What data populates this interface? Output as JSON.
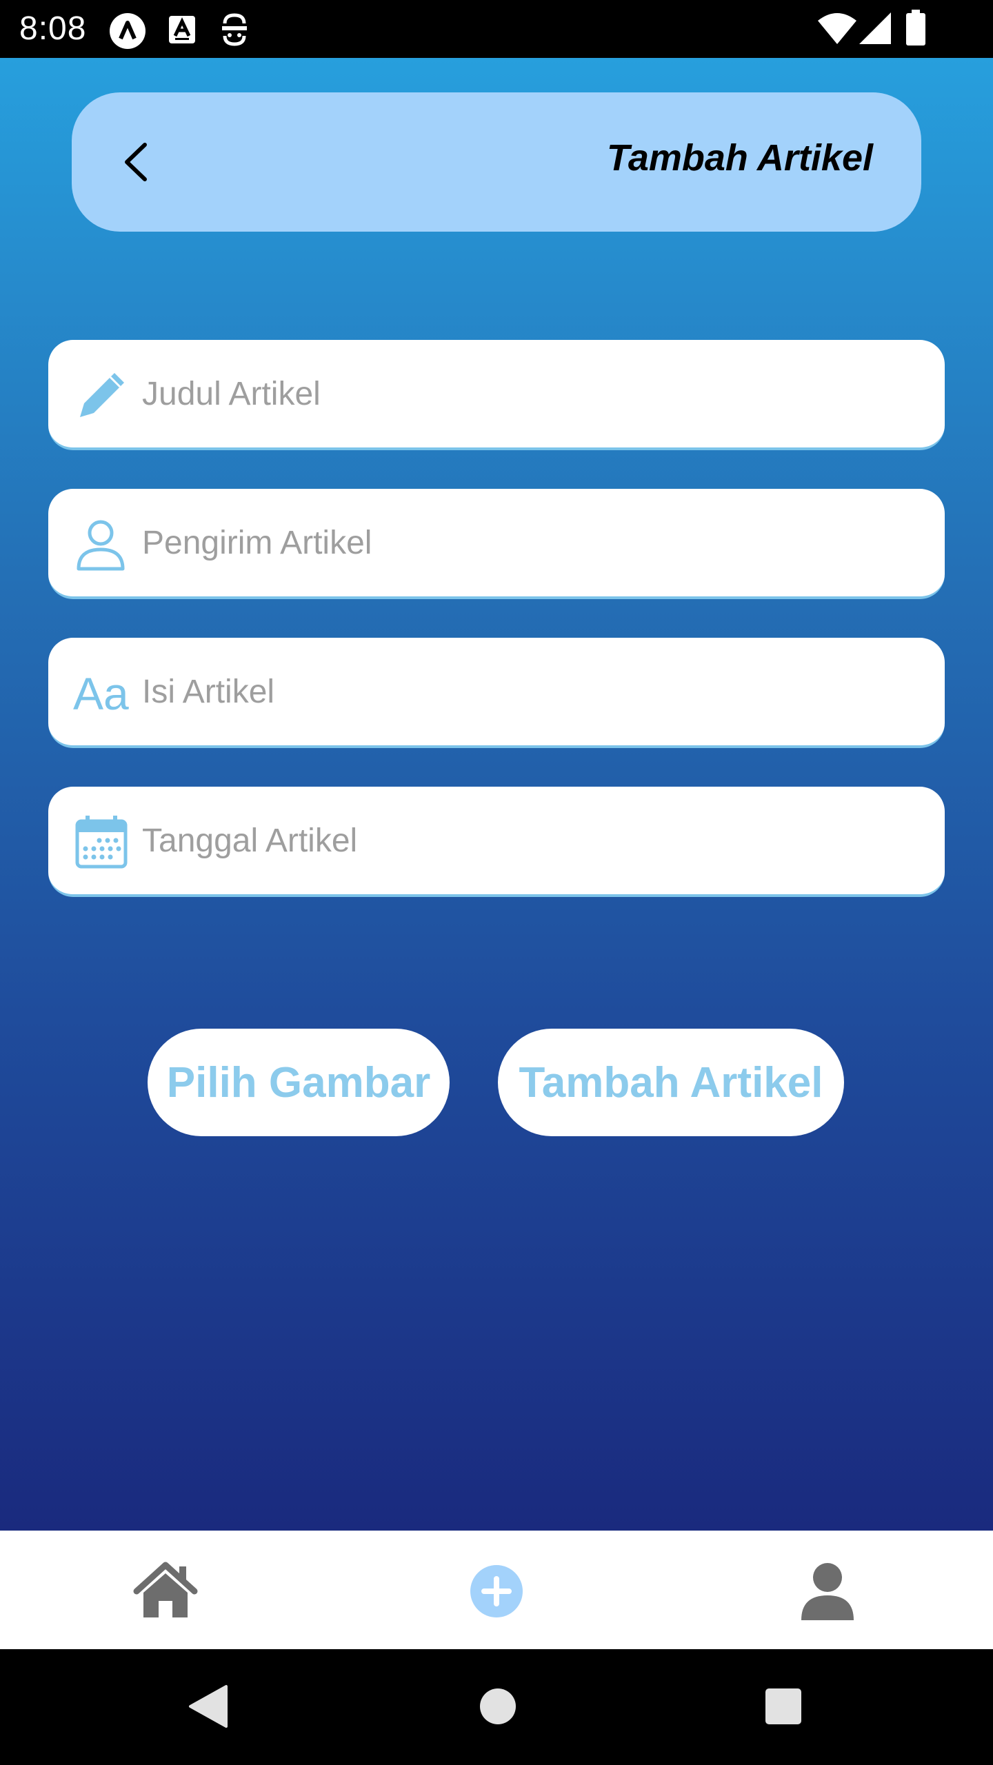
{
  "status_bar": {
    "time": "8:08",
    "left_icons": [
      "a-circle-icon",
      "a-box-icon",
      "face-icon"
    ],
    "right_icons": [
      "wifi-icon",
      "signal-icon",
      "battery-icon"
    ]
  },
  "header": {
    "title": "Tambah Artikel",
    "back_icon": "back-arrow-icon"
  },
  "form": {
    "fields": [
      {
        "placeholder": "Judul Artikel",
        "value": "",
        "icon": "pencil-icon"
      },
      {
        "placeholder": "Pengirim Artikel",
        "value": "",
        "icon": "person-icon"
      },
      {
        "placeholder": "Isi Artikel",
        "value": "",
        "icon": "text-format-icon"
      },
      {
        "placeholder": "Tanggal Artikel",
        "value": "",
        "icon": "calendar-icon"
      }
    ],
    "text_format_glyph": "Aa"
  },
  "actions": {
    "pick_image_label": "Pilih Gambar",
    "submit_label": "Tambah Artikel"
  },
  "bottom_nav": {
    "items": [
      "home-icon",
      "add-circle-icon",
      "profile-icon"
    ],
    "active": "add-circle-icon"
  },
  "colors": {
    "accent": "#8ccbec",
    "header_bg": "#a3d2fb",
    "gradient_top": "#279fdd",
    "gradient_bottom": "#1a2a7e",
    "nav_icon": "#6d6d6d",
    "nav_active": "#a3d2fb"
  }
}
